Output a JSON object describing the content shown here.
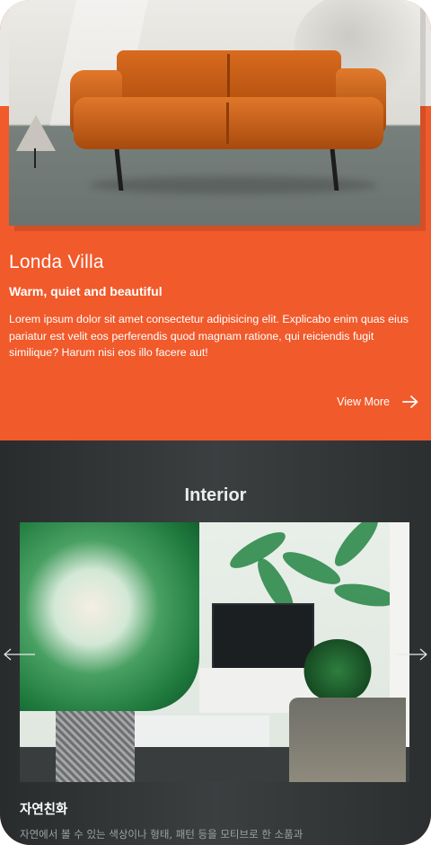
{
  "hero": {
    "title": "Londa Villa",
    "subtitle": "Warm, quiet and beautiful",
    "body": "Lorem ipsum dolor sit amet consectetur adipisicing elit. Explicabo enim quas eius pariatur est velit eos perferendis quod magnam ratione, qui reiciendis fugit similique? Harum nisi eos illo facere aut!",
    "view_more_label": "View More",
    "image_subject": "orange-leather-sofa"
  },
  "interior": {
    "section_title": "Interior",
    "slide": {
      "image_subject": "tropical-leaf-living-room",
      "title": "자연친화",
      "description": "자연에서 볼 수 있는 색상이나 형태, 패턴 등을 모티브로 한 소품과"
    }
  },
  "icons": {
    "view_more": "arrow-right-icon",
    "prev": "chevron-left-icon",
    "next": "chevron-right-icon"
  },
  "colors": {
    "accent": "#f15a2b",
    "dark_section": "#33373a",
    "text_light": "#ffffff",
    "text_muted": "#9da1a2"
  }
}
